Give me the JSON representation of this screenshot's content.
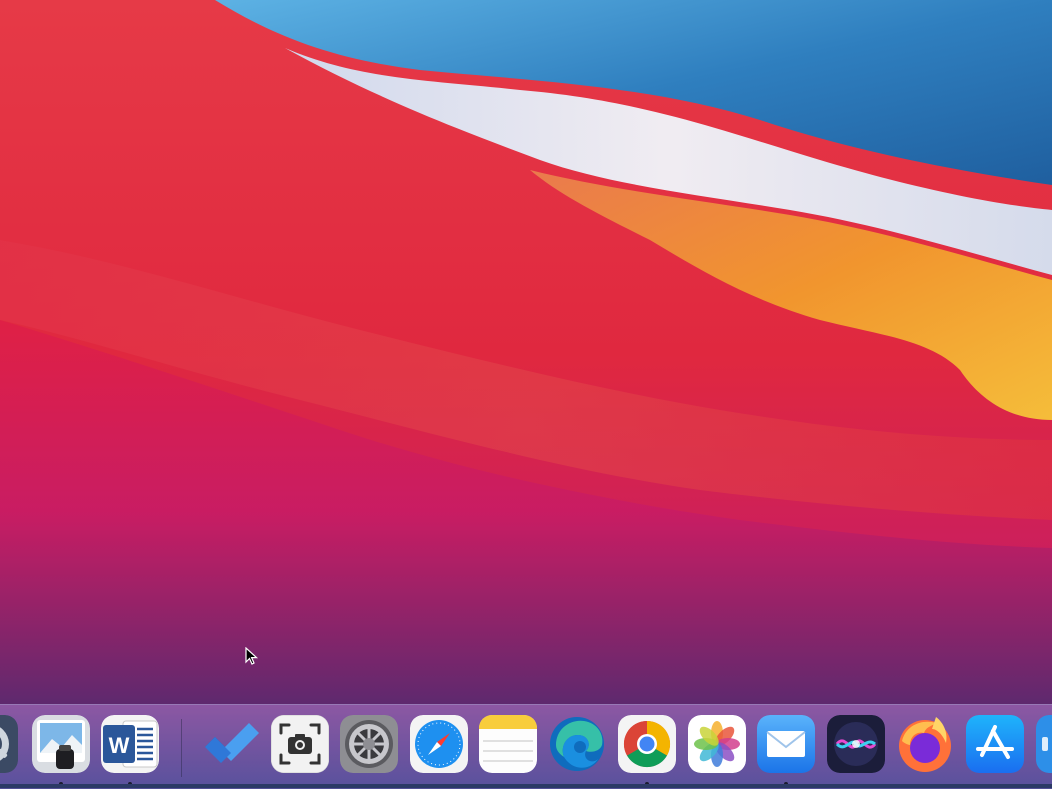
{
  "desktop": {
    "wallpaper": "macOS Big Sur"
  },
  "dock": {
    "apps": [
      {
        "id": "quicktime",
        "icon": "quicktime-icon",
        "running": false
      },
      {
        "id": "preview",
        "icon": "preview-icon",
        "running": true
      },
      {
        "id": "word",
        "icon": "word-icon",
        "running": true,
        "letter": "W"
      },
      {
        "id": "todo",
        "icon": "microsoft-todo-icon",
        "running": false
      },
      {
        "id": "screenshot",
        "icon": "screenshot-icon",
        "running": false
      },
      {
        "id": "settings",
        "icon": "system-preferences-icon",
        "running": false
      },
      {
        "id": "safari",
        "icon": "safari-icon",
        "running": false
      },
      {
        "id": "notes",
        "icon": "notes-icon",
        "running": false
      },
      {
        "id": "edge",
        "icon": "edge-icon",
        "running": false
      },
      {
        "id": "chrome",
        "icon": "chrome-icon",
        "running": true
      },
      {
        "id": "photos",
        "icon": "photos-icon",
        "running": false
      },
      {
        "id": "mail",
        "icon": "mail-icon",
        "running": true
      },
      {
        "id": "siri",
        "icon": "siri-icon",
        "running": false
      },
      {
        "id": "firefox",
        "icon": "firefox-icon",
        "running": false
      },
      {
        "id": "appstore",
        "icon": "app-store-icon",
        "running": false
      },
      {
        "id": "partial",
        "icon": "partial-app-icon",
        "running": false
      }
    ]
  },
  "colors": {
    "wallpaper_red": "#e0293f",
    "wallpaper_blue": "#2f7fbf",
    "wallpaper_orange": "#f2a23a",
    "wallpaper_magenta": "#c22068"
  }
}
